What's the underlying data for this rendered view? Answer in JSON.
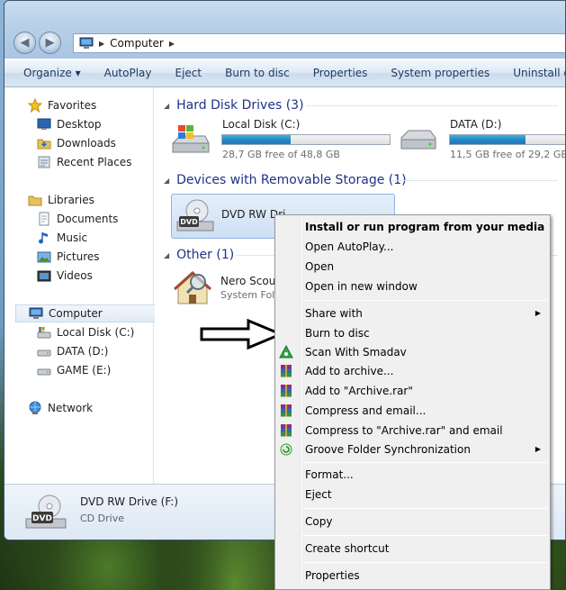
{
  "address": {
    "crumbs": [
      "Computer"
    ]
  },
  "toolbar": {
    "buttons": [
      {
        "label": "Organize ▾"
      },
      {
        "label": "AutoPlay"
      },
      {
        "label": "Eject"
      },
      {
        "label": "Burn to disc"
      },
      {
        "label": "Properties"
      },
      {
        "label": "System properties"
      },
      {
        "label": "Uninstall or ch"
      }
    ]
  },
  "nav": {
    "favorites": {
      "label": "Favorites",
      "items": [
        {
          "label": "Desktop"
        },
        {
          "label": "Downloads"
        },
        {
          "label": "Recent Places"
        }
      ]
    },
    "libraries": {
      "label": "Libraries",
      "items": [
        {
          "label": "Documents"
        },
        {
          "label": "Music"
        },
        {
          "label": "Pictures"
        },
        {
          "label": "Videos"
        }
      ]
    },
    "computer": {
      "label": "Computer",
      "items": [
        {
          "label": "Local Disk (C:)"
        },
        {
          "label": "DATA (D:)"
        },
        {
          "label": "GAME (E:)"
        }
      ]
    },
    "network": {
      "label": "Network"
    }
  },
  "groups": {
    "hdd": {
      "title": "Hard Disk Drives (3)",
      "drives": [
        {
          "name": "Local Disk (C:)",
          "free": "28,7 GB free of 48,8 GB",
          "used_fraction": 0.41
        },
        {
          "name": "DATA (D:)",
          "free": "11,5 GB free of 29,2 GB",
          "used_fraction": 0.61
        }
      ]
    },
    "removable": {
      "title": "Devices with Removable Storage (1)",
      "drive": {
        "name": "DVD RW Drive (F:)",
        "name_visible": "DVD RW Dri",
        "badge": "DVD"
      }
    },
    "other": {
      "title": "Other (1)",
      "item": {
        "name": "Nero Scout",
        "sub": "System Folde"
      }
    }
  },
  "details": {
    "name": "DVD RW Drive (F:)",
    "type": "CD Drive",
    "badge": "DVD"
  },
  "context_menu": {
    "items": [
      {
        "label": "Install or run program from your media",
        "bold": true
      },
      {
        "label": "Open AutoPlay..."
      },
      {
        "label": "Open"
      },
      {
        "label": "Open in new window"
      },
      {
        "label": "Share with",
        "submenu": true
      },
      {
        "label": "Burn to disc"
      },
      {
        "label": "Scan With Smadav",
        "icon": "smadav-icon"
      },
      {
        "label": "Add to archive...",
        "icon": "winrar-icon"
      },
      {
        "label": "Add to \"Archive.rar\"",
        "icon": "winrar-icon"
      },
      {
        "label": "Compress and email...",
        "icon": "winrar-icon"
      },
      {
        "label": "Compress to \"Archive.rar\" and email",
        "icon": "winrar-icon"
      },
      {
        "label": "Groove Folder Synchronization",
        "icon": "groove-icon",
        "submenu": true
      },
      {
        "label": "Format..."
      },
      {
        "label": "Eject"
      },
      {
        "label": "Copy"
      },
      {
        "label": "Create shortcut"
      },
      {
        "label": "Properties"
      }
    ]
  },
  "colors": {
    "group_header": "#1e3287",
    "bar_fill": "#2684c3",
    "menu_bg": "#f0f0f0"
  }
}
